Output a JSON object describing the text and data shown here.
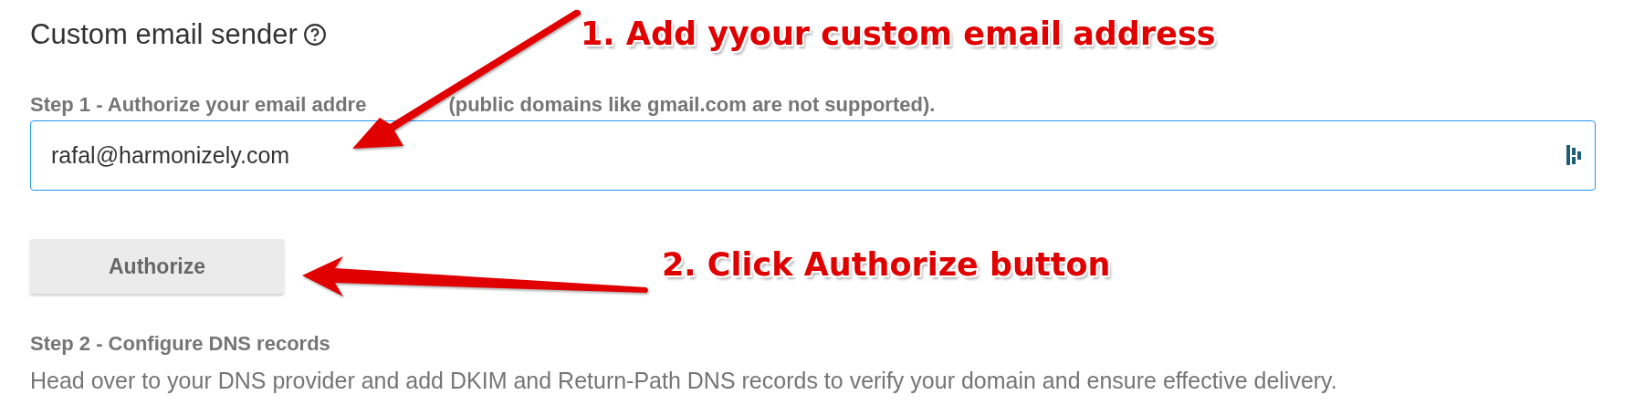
{
  "section": {
    "title": "Custom email sender",
    "step1": {
      "label_parts": [
        "Step 1 - Authorize your email addre",
        "(public domains like gmail.com are not supported)."
      ],
      "email_field": {
        "value": "rafal@harmonizely.com",
        "focused": true
      },
      "button": "Authorize"
    },
    "step2": {
      "label": "Step 2 - Configure DNS records",
      "description": "Head over to your DNS provider and add DKIM and Return-Path DNS records to verify your domain and ensure effective delivery."
    }
  },
  "annotations": [
    {
      "text": "1. Add yyour custom email address",
      "kind": "field"
    },
    {
      "text": "2. Click Authorize button",
      "kind": "button"
    }
  ]
}
